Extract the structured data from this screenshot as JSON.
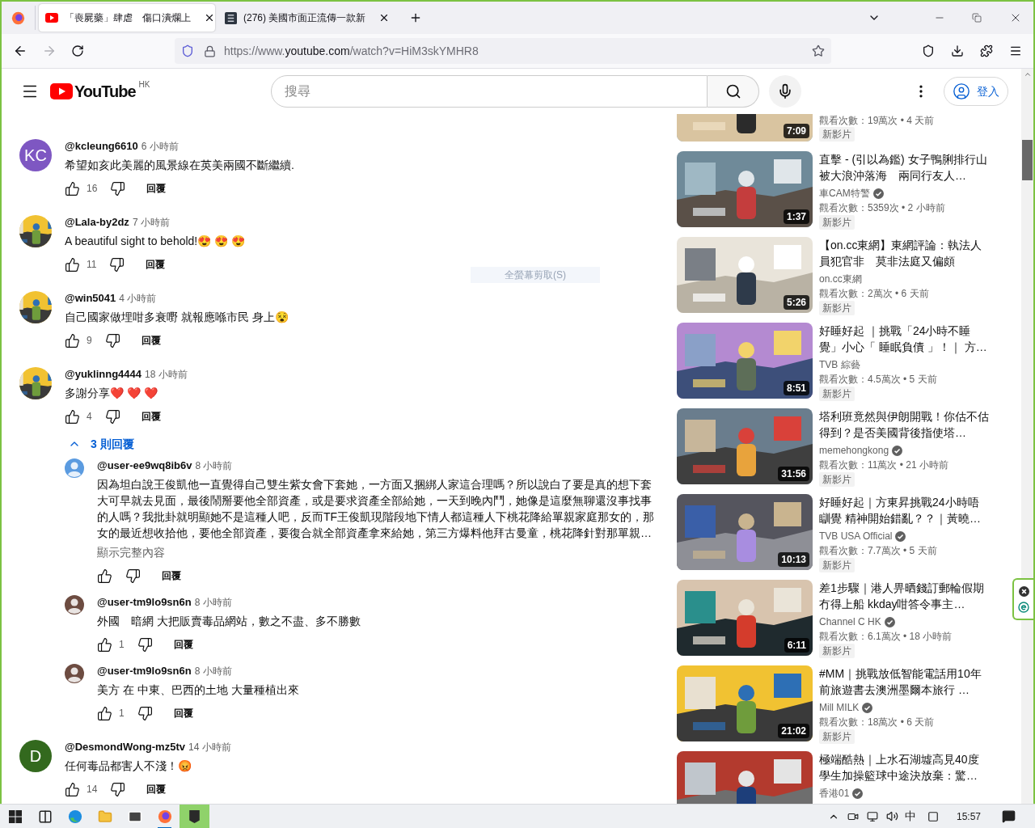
{
  "browser": {
    "tabs": [
      {
        "title": "「喪屍藥」肆虐　傷口潰爛上",
        "selected": true
      },
      {
        "title": "(276) 美國市面正流傳一款新",
        "selected": false
      }
    ],
    "url": {
      "prefix": "https://www.",
      "domain": "youtube.com",
      "path": "/watch?v=HiM3skYMHR8"
    }
  },
  "header": {
    "logo": "YouTube",
    "region": "HK",
    "search_placeholder": "搜尋",
    "sign_in": "登入"
  },
  "comments": [
    {
      "author": "@kcleung6610",
      "time": "6 小時前",
      "text": "希望如亥此美麗的風景線在英美兩國不斷繼續.",
      "likes": "16",
      "reply_label": "回覆",
      "avatar": {
        "kind": "initials",
        "initials": "KC",
        "color": "#7e57c2"
      }
    },
    {
      "author": "@Lala-by2dz",
      "time": "7 小時前",
      "text": "A beautiful sight to behold!😍 😍 😍",
      "likes": "11",
      "reply_label": "回覆"
    },
    {
      "author": "@win5041",
      "time": "4 小時前",
      "text": "自己國家做埋咁多衰嘢 就報應喺市民 身上😵",
      "likes": "9",
      "reply_label": "回覆"
    },
    {
      "author": "@yuklinng4444",
      "time": "18 小時前",
      "text": "多謝分享❤️ ❤️ ❤️",
      "likes": "4",
      "reply_label": "回覆",
      "replies_toggle": {
        "label": "3 則回覆",
        "expanded": true
      },
      "replies": [
        {
          "author": "@user-ee9wq8ib6v",
          "time": "8 小時前",
          "text": "因為坦白說王俊凱他一直覺得自己雙生紫女會下套她，一方面又捆綁人家這合理嗎？所以說白了要是真的想下套大可早就去見面，最後鬧掰要他全部資產，或是要求資產全部給她，一天到晚內鬥，她像是這麼無聊還沒事找事的人嗎？我批卦就明顯她不是這種人吧，反而TF王俊凱現階段地下情人都這種人下桃花降給單親家庭那女的，那女的最近想收拾他，要他全部資產，要復合就全部資產拿來給她，第三方爆料他拜古曼童，桃花降針對那單親…",
          "show_more": "顯示完整內容",
          "reply_label": "回覆",
          "avatar": {
            "kind": "silhouette",
            "color": "#5b9be0"
          }
        },
        {
          "author": "@user-tm9lo9sn6n",
          "time": "8 小時前",
          "text": "外國　暗網  大把販賣毒品網站，數之不盡、多不勝數",
          "likes": "1",
          "reply_label": "回覆",
          "avatar": {
            "kind": "silhouette",
            "color": "#6d4c41"
          }
        },
        {
          "author": "@user-tm9lo9sn6n",
          "time": "8 小時前",
          "text": "美方  在  中東、巴西的土地  大量種植出來",
          "likes": "1",
          "reply_label": "回覆",
          "avatar": {
            "kind": "silhouette",
            "color": "#6d4c41"
          }
        }
      ]
    },
    {
      "author": "@DesmondWong-mz5tv",
      "time": "14 小時前",
      "text": "任何毒品都害人不淺！😡",
      "likes": "14",
      "reply_label": "回覆",
      "avatar": {
        "kind": "initials",
        "initials": "D",
        "color": "#33691e"
      }
    }
  ],
  "snip_hint": "全螢幕剪取(S)",
  "sidebar": {
    "videos": [
      {
        "duration": "7:09",
        "views": "觀看次數：19萬次 • 4 天前",
        "badge": "新影片"
      },
      {
        "title": "直擊 - (引以為鑑) 女子鴨脷排行山被大浪沖落海　兩同行友人…",
        "channel": "車CAM特警",
        "verified": true,
        "views": "觀看次數：5359次 • 2 小時前",
        "badge": "新影片",
        "duration": "1:37"
      },
      {
        "title": "【on.cc東網】東網評論：執法人員犯官非　莫非法庭又偏頗",
        "channel": "on.cc東網",
        "verified": false,
        "views": "觀看次數：2萬次 • 6 天前",
        "badge": "新影片",
        "duration": "5:26"
      },
      {
        "title": "好睡好起 ｜挑戰「24小時不睡覺」小心「 睡眠負債 」！｜ 方…",
        "channel": "TVB 綜藝",
        "verified": false,
        "views": "觀看次數：4.5萬次 • 5 天前",
        "badge": "新影片",
        "duration": "8:51"
      },
      {
        "title": "塔利班竟然與伊朗開戰！你估不估得到？是否美國背後指使塔…",
        "channel": "memehongkong",
        "verified": true,
        "views": "觀看次數：11萬次 • 21 小時前",
        "badge": "新影片",
        "duration": "31:56"
      },
      {
        "title": "好睡好起｜方東昇挑戰24小時唔瞓覺 精神開始錯亂？？｜黃曉…",
        "channel": "TVB USA Official",
        "verified": true,
        "views": "觀看次數：7.7萬次 • 5 天前",
        "badge": "新影片",
        "duration": "10:13"
      },
      {
        "title": "差1步驟｜港人畀晒錢訂郵輪假期冇得上船 kkday咁答令事主…",
        "channel": "Channel C HK",
        "verified": true,
        "views": "觀看次數：6.1萬次 • 18 小時前",
        "badge": "新影片",
        "duration": "6:11"
      },
      {
        "title": "#MM｜挑戰放低智能電話用10年前旅遊書去澳洲墨爾本旅行 …",
        "channel": "Mill MILK",
        "verified": true,
        "views": "觀看次數：18萬次 • 6 天前",
        "badge": "新影片",
        "duration": "21:02"
      },
      {
        "title": "極端酷熱｜上水石湖墟高見40度學生加操籃球中途決放棄：驚…",
        "channel": "香港01",
        "verified": true
      }
    ]
  },
  "taskbar": {
    "apps": [
      {
        "kind": "task-view",
        "running": false,
        "selected": false
      },
      {
        "kind": "edge",
        "running": false,
        "selected": false
      },
      {
        "kind": "folder",
        "running": false,
        "selected": false
      },
      {
        "kind": "mail",
        "running": false,
        "selected": false
      },
      {
        "kind": "firefox",
        "running": true,
        "selected": false
      },
      {
        "kind": "epic",
        "running": false,
        "selected": true
      }
    ],
    "input_method": "中",
    "clock": "15:57"
  }
}
